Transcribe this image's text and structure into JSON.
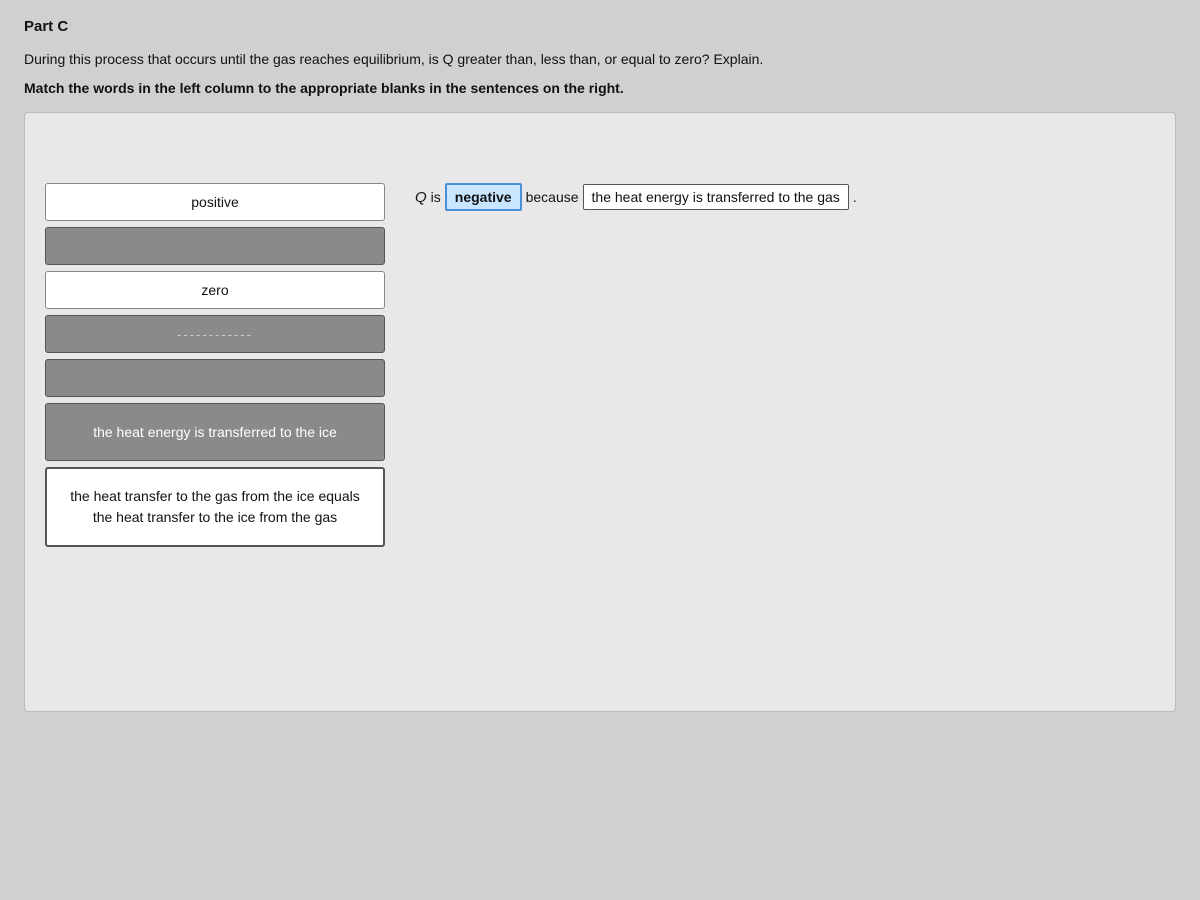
{
  "page": {
    "part_label": "Part C",
    "question_text": "During this process that occurs until the gas reaches equilibrium, is Q greater than, less than, or equal to zero? Explain.",
    "instruction_text": "Match the words in the left column to the appropriate blanks in the sentences on the right.",
    "left_column": {
      "items": [
        {
          "id": "positive",
          "label": "positive",
          "style": "white-bg"
        },
        {
          "id": "empty1",
          "label": "",
          "style": "empty"
        },
        {
          "id": "zero",
          "label": "zero",
          "style": "white-bg"
        },
        {
          "id": "dashed",
          "label": "------------",
          "style": "dashed"
        },
        {
          "id": "empty2",
          "label": "",
          "style": "empty"
        },
        {
          "id": "heat-to-ice",
          "label": "the heat energy is transferred to the ice",
          "style": "multiline"
        },
        {
          "id": "heat-transfer-equal",
          "label": "the heat transfer to the gas from the ice equals the heat transfer to the ice from the gas",
          "style": "multiline-long"
        }
      ]
    },
    "right_column": {
      "sentence": {
        "q_label": "Q",
        "is_text": "is",
        "blank1": "negative",
        "because_text": "because",
        "blank2": "the heat energy is transferred to the gas",
        "period": "."
      }
    }
  }
}
